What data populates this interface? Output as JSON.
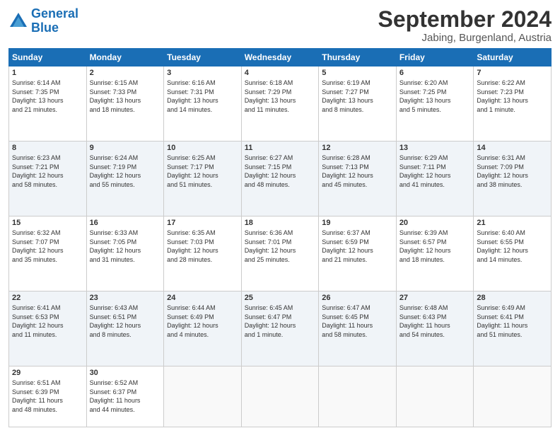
{
  "logo": {
    "line1": "General",
    "line2": "Blue"
  },
  "title": "September 2024",
  "location": "Jabing, Burgenland, Austria",
  "headers": [
    "Sunday",
    "Monday",
    "Tuesday",
    "Wednesday",
    "Thursday",
    "Friday",
    "Saturday"
  ],
  "weeks": [
    [
      {
        "day": "1",
        "info": "Sunrise: 6:14 AM\nSunset: 7:35 PM\nDaylight: 13 hours\nand 21 minutes."
      },
      {
        "day": "2",
        "info": "Sunrise: 6:15 AM\nSunset: 7:33 PM\nDaylight: 13 hours\nand 18 minutes."
      },
      {
        "day": "3",
        "info": "Sunrise: 6:16 AM\nSunset: 7:31 PM\nDaylight: 13 hours\nand 14 minutes."
      },
      {
        "day": "4",
        "info": "Sunrise: 6:18 AM\nSunset: 7:29 PM\nDaylight: 13 hours\nand 11 minutes."
      },
      {
        "day": "5",
        "info": "Sunrise: 6:19 AM\nSunset: 7:27 PM\nDaylight: 13 hours\nand 8 minutes."
      },
      {
        "day": "6",
        "info": "Sunrise: 6:20 AM\nSunset: 7:25 PM\nDaylight: 13 hours\nand 5 minutes."
      },
      {
        "day": "7",
        "info": "Sunrise: 6:22 AM\nSunset: 7:23 PM\nDaylight: 13 hours\nand 1 minute."
      }
    ],
    [
      {
        "day": "8",
        "info": "Sunrise: 6:23 AM\nSunset: 7:21 PM\nDaylight: 12 hours\nand 58 minutes."
      },
      {
        "day": "9",
        "info": "Sunrise: 6:24 AM\nSunset: 7:19 PM\nDaylight: 12 hours\nand 55 minutes."
      },
      {
        "day": "10",
        "info": "Sunrise: 6:25 AM\nSunset: 7:17 PM\nDaylight: 12 hours\nand 51 minutes."
      },
      {
        "day": "11",
        "info": "Sunrise: 6:27 AM\nSunset: 7:15 PM\nDaylight: 12 hours\nand 48 minutes."
      },
      {
        "day": "12",
        "info": "Sunrise: 6:28 AM\nSunset: 7:13 PM\nDaylight: 12 hours\nand 45 minutes."
      },
      {
        "day": "13",
        "info": "Sunrise: 6:29 AM\nSunset: 7:11 PM\nDaylight: 12 hours\nand 41 minutes."
      },
      {
        "day": "14",
        "info": "Sunrise: 6:31 AM\nSunset: 7:09 PM\nDaylight: 12 hours\nand 38 minutes."
      }
    ],
    [
      {
        "day": "15",
        "info": "Sunrise: 6:32 AM\nSunset: 7:07 PM\nDaylight: 12 hours\nand 35 minutes."
      },
      {
        "day": "16",
        "info": "Sunrise: 6:33 AM\nSunset: 7:05 PM\nDaylight: 12 hours\nand 31 minutes."
      },
      {
        "day": "17",
        "info": "Sunrise: 6:35 AM\nSunset: 7:03 PM\nDaylight: 12 hours\nand 28 minutes."
      },
      {
        "day": "18",
        "info": "Sunrise: 6:36 AM\nSunset: 7:01 PM\nDaylight: 12 hours\nand 25 minutes."
      },
      {
        "day": "19",
        "info": "Sunrise: 6:37 AM\nSunset: 6:59 PM\nDaylight: 12 hours\nand 21 minutes."
      },
      {
        "day": "20",
        "info": "Sunrise: 6:39 AM\nSunset: 6:57 PM\nDaylight: 12 hours\nand 18 minutes."
      },
      {
        "day": "21",
        "info": "Sunrise: 6:40 AM\nSunset: 6:55 PM\nDaylight: 12 hours\nand 14 minutes."
      }
    ],
    [
      {
        "day": "22",
        "info": "Sunrise: 6:41 AM\nSunset: 6:53 PM\nDaylight: 12 hours\nand 11 minutes."
      },
      {
        "day": "23",
        "info": "Sunrise: 6:43 AM\nSunset: 6:51 PM\nDaylight: 12 hours\nand 8 minutes."
      },
      {
        "day": "24",
        "info": "Sunrise: 6:44 AM\nSunset: 6:49 PM\nDaylight: 12 hours\nand 4 minutes."
      },
      {
        "day": "25",
        "info": "Sunrise: 6:45 AM\nSunset: 6:47 PM\nDaylight: 12 hours\nand 1 minute."
      },
      {
        "day": "26",
        "info": "Sunrise: 6:47 AM\nSunset: 6:45 PM\nDaylight: 11 hours\nand 58 minutes."
      },
      {
        "day": "27",
        "info": "Sunrise: 6:48 AM\nSunset: 6:43 PM\nDaylight: 11 hours\nand 54 minutes."
      },
      {
        "day": "28",
        "info": "Sunrise: 6:49 AM\nSunset: 6:41 PM\nDaylight: 11 hours\nand 51 minutes."
      }
    ],
    [
      {
        "day": "29",
        "info": "Sunrise: 6:51 AM\nSunset: 6:39 PM\nDaylight: 11 hours\nand 48 minutes."
      },
      {
        "day": "30",
        "info": "Sunrise: 6:52 AM\nSunset: 6:37 PM\nDaylight: 11 hours\nand 44 minutes."
      },
      {
        "day": "",
        "info": ""
      },
      {
        "day": "",
        "info": ""
      },
      {
        "day": "",
        "info": ""
      },
      {
        "day": "",
        "info": ""
      },
      {
        "day": "",
        "info": ""
      }
    ]
  ]
}
